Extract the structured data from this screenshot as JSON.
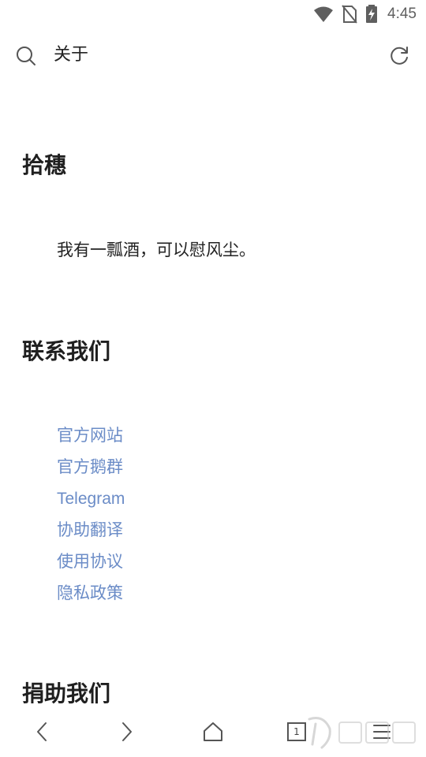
{
  "status_bar": {
    "time": "4:45",
    "icons": [
      "wifi-icon",
      "no-sim-icon",
      "battery-charging-icon"
    ]
  },
  "header": {
    "title": "关于",
    "icons": [
      "search-icon",
      "refresh-icon"
    ]
  },
  "sections": [
    {
      "title": "拾穗"
    },
    {
      "title": "联系我们"
    },
    {
      "title": "捐助我们"
    }
  ],
  "intro": {
    "text": "我有一瓢酒，可以慰风尘。"
  },
  "links": [
    {
      "label": "官方网站"
    },
    {
      "label": "官方鹅群"
    },
    {
      "label": "Telegram"
    },
    {
      "label": "协助翻译"
    },
    {
      "label": "使用协议"
    },
    {
      "label": "隐私政策"
    }
  ],
  "bottom_nav": {
    "tab_count": "1",
    "icons": [
      "back-icon",
      "forward-icon",
      "home-icon",
      "tabs-icon",
      "menu-icon"
    ]
  },
  "colors": {
    "link": "#6b8cc7",
    "text": "#1f1f1f",
    "icon": "#5f5f5f",
    "background": "#ffffff"
  }
}
